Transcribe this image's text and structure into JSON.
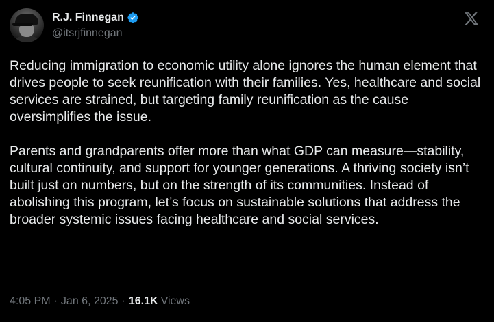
{
  "author": {
    "display_name": "R.J. Finnegan",
    "handle": "@itsrjfinnegan",
    "verified": true,
    "verified_color": "#1d9bf0"
  },
  "logo_icon": "x-logo-icon",
  "tweet": {
    "paragraphs": [
      "Reducing immigration to economic utility alone ignores the human element that drives people to seek reunification with their families. Yes, healthcare and social services are strained, but targeting family reunification as the cause oversimplifies the issue.",
      "Parents and grandparents offer more than what GDP can measure—stability, cultural continuity, and support for younger generations. A thriving society isn’t built just on numbers, but on the strength of its communities. Instead of abolishing this program, let’s focus on sustainable solutions that address the broader systemic issues facing healthcare and social services."
    ]
  },
  "meta": {
    "time": "4:05 PM",
    "separator": "·",
    "date": "Jan 6, 2025",
    "views_count": "16.1K",
    "views_label": "Views"
  },
  "colors": {
    "background": "#000000",
    "text": "#e7e9ea",
    "secondary_text": "#71767b"
  }
}
